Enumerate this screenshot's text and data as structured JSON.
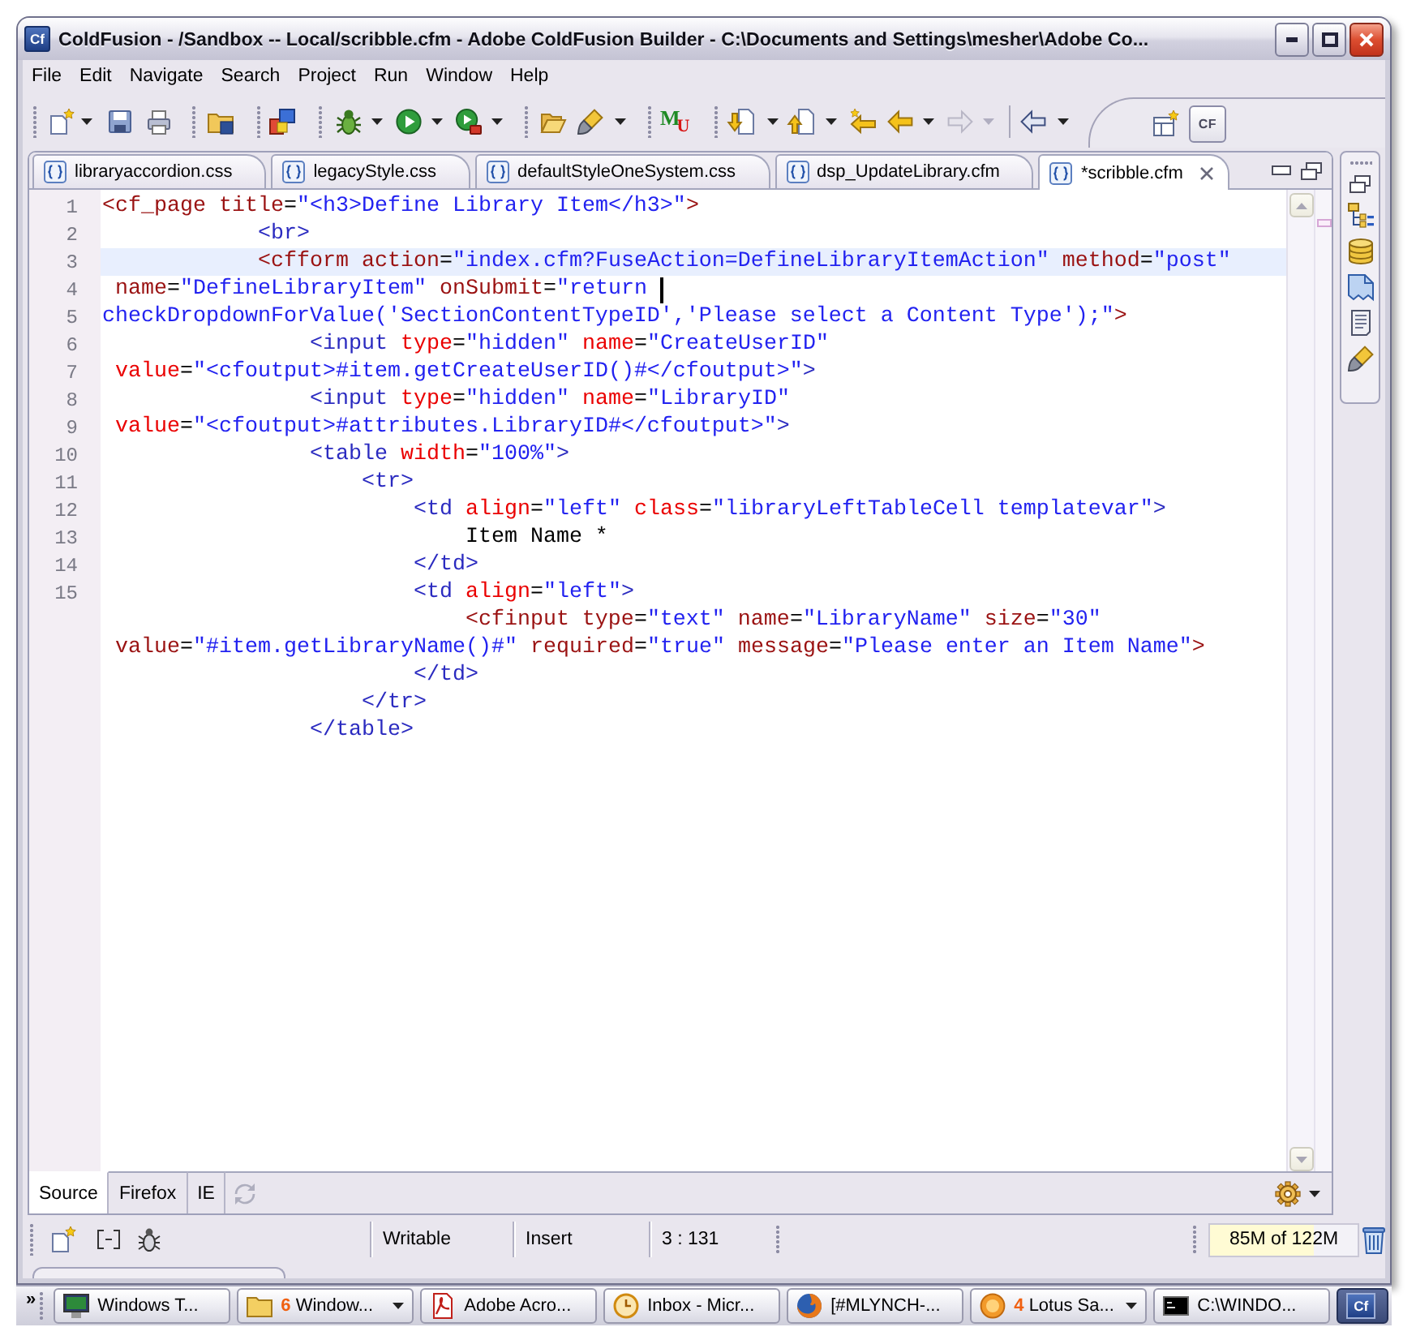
{
  "window": {
    "app_logo": "Cf",
    "title": "ColdFusion - /Sandbox -- Local/scribble.cfm - Adobe ColdFusion Builder - C:\\Documents and Settings\\mesher\\Adobe Co..."
  },
  "menu_bar": [
    "File",
    "Edit",
    "Navigate",
    "Search",
    "Project",
    "Run",
    "Window",
    "Help"
  ],
  "toolbar": {
    "letter_logo": [
      "M",
      "U"
    ],
    "forward": {
      "disabled": true
    },
    "perspective": {
      "label": "CF",
      "selected": true
    }
  },
  "editor_tabs": [
    {
      "label": "libraryaccordion.css",
      "selected": false
    },
    {
      "label": "legacyStyle.css",
      "selected": false
    },
    {
      "label": "defaultStyleOneSystem.css",
      "selected": false
    },
    {
      "label": "dsp_UpdateLibrary.cfm",
      "selected": false
    },
    {
      "label": "*scribble.cfm",
      "selected": true
    }
  ],
  "editor": {
    "lines": [
      {
        "number": "1",
        "highlighted": false,
        "cursor": false,
        "tokens": [
          {
            "kind": "cf",
            "text": "<cf_page title"
          },
          {
            "kind": "plain",
            "text": "="
          },
          {
            "kind": "value",
            "text": "\"<h3>Define Library Item</h3>\""
          },
          {
            "kind": "cf",
            "text": ">"
          }
        ]
      },
      {
        "number": "2",
        "highlighted": false,
        "cursor": false,
        "tokens": [
          {
            "kind": "html",
            "text": "            <br>"
          }
        ]
      },
      {
        "number": "3",
        "highlighted": true,
        "cursor": false,
        "tokens": [
          {
            "kind": "cf",
            "text": "            <cfform action"
          },
          {
            "kind": "plain",
            "text": "="
          },
          {
            "kind": "value",
            "text": "\"index.cfm?FuseAction=DefineLibraryItemAction\""
          },
          {
            "kind": "cf",
            "text": " method"
          },
          {
            "kind": "plain",
            "text": "="
          },
          {
            "kind": "value",
            "text": "\"post\""
          }
        ]
      },
      {
        "number": "4",
        "highlighted": false,
        "cursor": true,
        "tokens": [
          {
            "kind": "cf",
            "text": " name"
          },
          {
            "kind": "plain",
            "text": "="
          },
          {
            "kind": "value",
            "text": "\"DefineLibraryItem\""
          },
          {
            "kind": "cf",
            "text": " onSubmit"
          },
          {
            "kind": "plain",
            "text": "="
          },
          {
            "kind": "value",
            "text": "\"return "
          }
        ]
      },
      {
        "number": "5",
        "highlighted": false,
        "cursor": false,
        "tokens": [
          {
            "kind": "value",
            "text": "checkDropdownForValue('SectionContentTypeID','Please select a Content Type');\""
          },
          {
            "kind": "cf",
            "text": ">"
          }
        ]
      },
      {
        "number": "6",
        "highlighted": false,
        "cursor": false,
        "tokens": [
          {
            "kind": "html",
            "text": "                <input"
          },
          {
            "kind": "attr",
            "text": " type"
          },
          {
            "kind": "plain",
            "text": "="
          },
          {
            "kind": "value",
            "text": "\"hidden\""
          },
          {
            "kind": "attr",
            "text": " name"
          },
          {
            "kind": "plain",
            "text": "="
          },
          {
            "kind": "value",
            "text": "\"CreateUserID\""
          }
        ]
      },
      {
        "number": "7",
        "highlighted": false,
        "cursor": false,
        "tokens": [
          {
            "kind": "attr",
            "text": " value"
          },
          {
            "kind": "plain",
            "text": "="
          },
          {
            "kind": "value",
            "text": "\"<cfoutput>#item.getCreateUserID()#</cfoutput>\""
          },
          {
            "kind": "html",
            "text": ">"
          }
        ]
      },
      {
        "number": "8",
        "highlighted": false,
        "cursor": false,
        "tokens": [
          {
            "kind": "html",
            "text": "                <input"
          },
          {
            "kind": "attr",
            "text": " type"
          },
          {
            "kind": "plain",
            "text": "="
          },
          {
            "kind": "value",
            "text": "\"hidden\""
          },
          {
            "kind": "attr",
            "text": " name"
          },
          {
            "kind": "plain",
            "text": "="
          },
          {
            "kind": "value",
            "text": "\"LibraryID\""
          }
        ]
      },
      {
        "number": "9",
        "highlighted": false,
        "cursor": false,
        "tokens": [
          {
            "kind": "attr",
            "text": " value"
          },
          {
            "kind": "plain",
            "text": "="
          },
          {
            "kind": "value",
            "text": "\"<cfoutput>#attributes.LibraryID#</cfoutput>\""
          },
          {
            "kind": "html",
            "text": ">"
          }
        ]
      },
      {
        "number": "10",
        "highlighted": false,
        "cursor": false,
        "tokens": [
          {
            "kind": "html",
            "text": "                <table"
          },
          {
            "kind": "attr",
            "text": " width"
          },
          {
            "kind": "plain",
            "text": "="
          },
          {
            "kind": "value",
            "text": "\"100%\""
          },
          {
            "kind": "html",
            "text": ">"
          }
        ]
      },
      {
        "number": "11",
        "highlighted": false,
        "cursor": false,
        "tokens": [
          {
            "kind": "html",
            "text": "                    <tr>"
          }
        ]
      },
      {
        "number": "12",
        "highlighted": false,
        "cursor": false,
        "tokens": [
          {
            "kind": "html",
            "text": "                        <td"
          },
          {
            "kind": "attr",
            "text": " align"
          },
          {
            "kind": "plain",
            "text": "="
          },
          {
            "kind": "value",
            "text": "\"left\""
          },
          {
            "kind": "attr",
            "text": " class"
          },
          {
            "kind": "plain",
            "text": "="
          },
          {
            "kind": "value",
            "text": "\"libraryLeftTableCell templatevar\""
          },
          {
            "kind": "html",
            "text": ">"
          }
        ]
      },
      {
        "number": "13",
        "highlighted": false,
        "cursor": false,
        "tokens": [
          {
            "kind": "plain",
            "text": "                            Item Name *"
          }
        ]
      },
      {
        "number": "14",
        "highlighted": false,
        "cursor": false,
        "tokens": [
          {
            "kind": "html",
            "text": "                        </td>"
          }
        ]
      },
      {
        "number": "15",
        "highlighted": false,
        "cursor": false,
        "tokens": [
          {
            "kind": "html",
            "text": "                        <td"
          },
          {
            "kind": "attr",
            "text": " align"
          },
          {
            "kind": "plain",
            "text": "="
          },
          {
            "kind": "value",
            "text": "\"left\""
          },
          {
            "kind": "html",
            "text": ">"
          }
        ]
      },
      {
        "highlighted": false,
        "cursor": false,
        "tokens": [
          {
            "kind": "cf",
            "text": "                            <cfinput type"
          },
          {
            "kind": "plain",
            "text": "="
          },
          {
            "kind": "value",
            "text": "\"text\""
          },
          {
            "kind": "cf",
            "text": " name"
          },
          {
            "kind": "plain",
            "text": "="
          },
          {
            "kind": "value",
            "text": "\"LibraryName\""
          },
          {
            "kind": "cf",
            "text": " size"
          },
          {
            "kind": "plain",
            "text": "="
          },
          {
            "kind": "value",
            "text": "\"30\""
          }
        ]
      },
      {
        "highlighted": false,
        "cursor": false,
        "tokens": [
          {
            "kind": "cf",
            "text": " value"
          },
          {
            "kind": "plain",
            "text": "="
          },
          {
            "kind": "value",
            "text": "\"#item.getLibraryName()#\""
          },
          {
            "kind": "cf",
            "text": " required"
          },
          {
            "kind": "plain",
            "text": "="
          },
          {
            "kind": "value",
            "text": "\"true\""
          },
          {
            "kind": "cf",
            "text": " message"
          },
          {
            "kind": "plain",
            "text": "="
          },
          {
            "kind": "value",
            "text": "\"Please enter an Item Name\""
          },
          {
            "kind": "cf",
            "text": ">"
          }
        ]
      },
      {
        "highlighted": false,
        "cursor": false,
        "tokens": [
          {
            "kind": "html",
            "text": "                        </td>"
          }
        ]
      },
      {
        "highlighted": false,
        "cursor": false,
        "tokens": [
          {
            "kind": "html",
            "text": "                    </tr>"
          }
        ]
      },
      {
        "highlighted": false,
        "cursor": false,
        "tokens": [
          {
            "kind": "html",
            "text": "                </table>"
          }
        ]
      }
    ]
  },
  "bottom_tabs": [
    {
      "label": "Source",
      "selected": true
    },
    {
      "label": "Firefox",
      "selected": false
    },
    {
      "label": "IE",
      "selected": false
    }
  ],
  "sync": {
    "disabled": true
  },
  "status_bar": {
    "fields": [
      "Writable",
      "Insert",
      "3 : 131"
    ],
    "memory": {
      "label": "85M of 122M",
      "level": 0.7
    }
  },
  "taskbar": {
    "overflow": "»",
    "items": [
      {
        "label": "Windows T...",
        "selected": false,
        "grouped": false
      },
      {
        "count": "6",
        "label": "Window...",
        "selected": false,
        "grouped": true
      },
      {
        "label": "Adobe Acro...",
        "selected": false,
        "grouped": false
      },
      {
        "label": "Inbox - Micr...",
        "selected": false,
        "grouped": false
      },
      {
        "label": "[#MLYNCH-...",
        "selected": false,
        "grouped": false
      },
      {
        "count": "4",
        "label": "Lotus Sa...",
        "selected": false,
        "grouped": true
      },
      {
        "label": "C:\\WINDO...",
        "selected": false,
        "grouped": false
      },
      {
        "logo": "Cf",
        "selected": true,
        "grouped": false
      }
    ]
  }
}
